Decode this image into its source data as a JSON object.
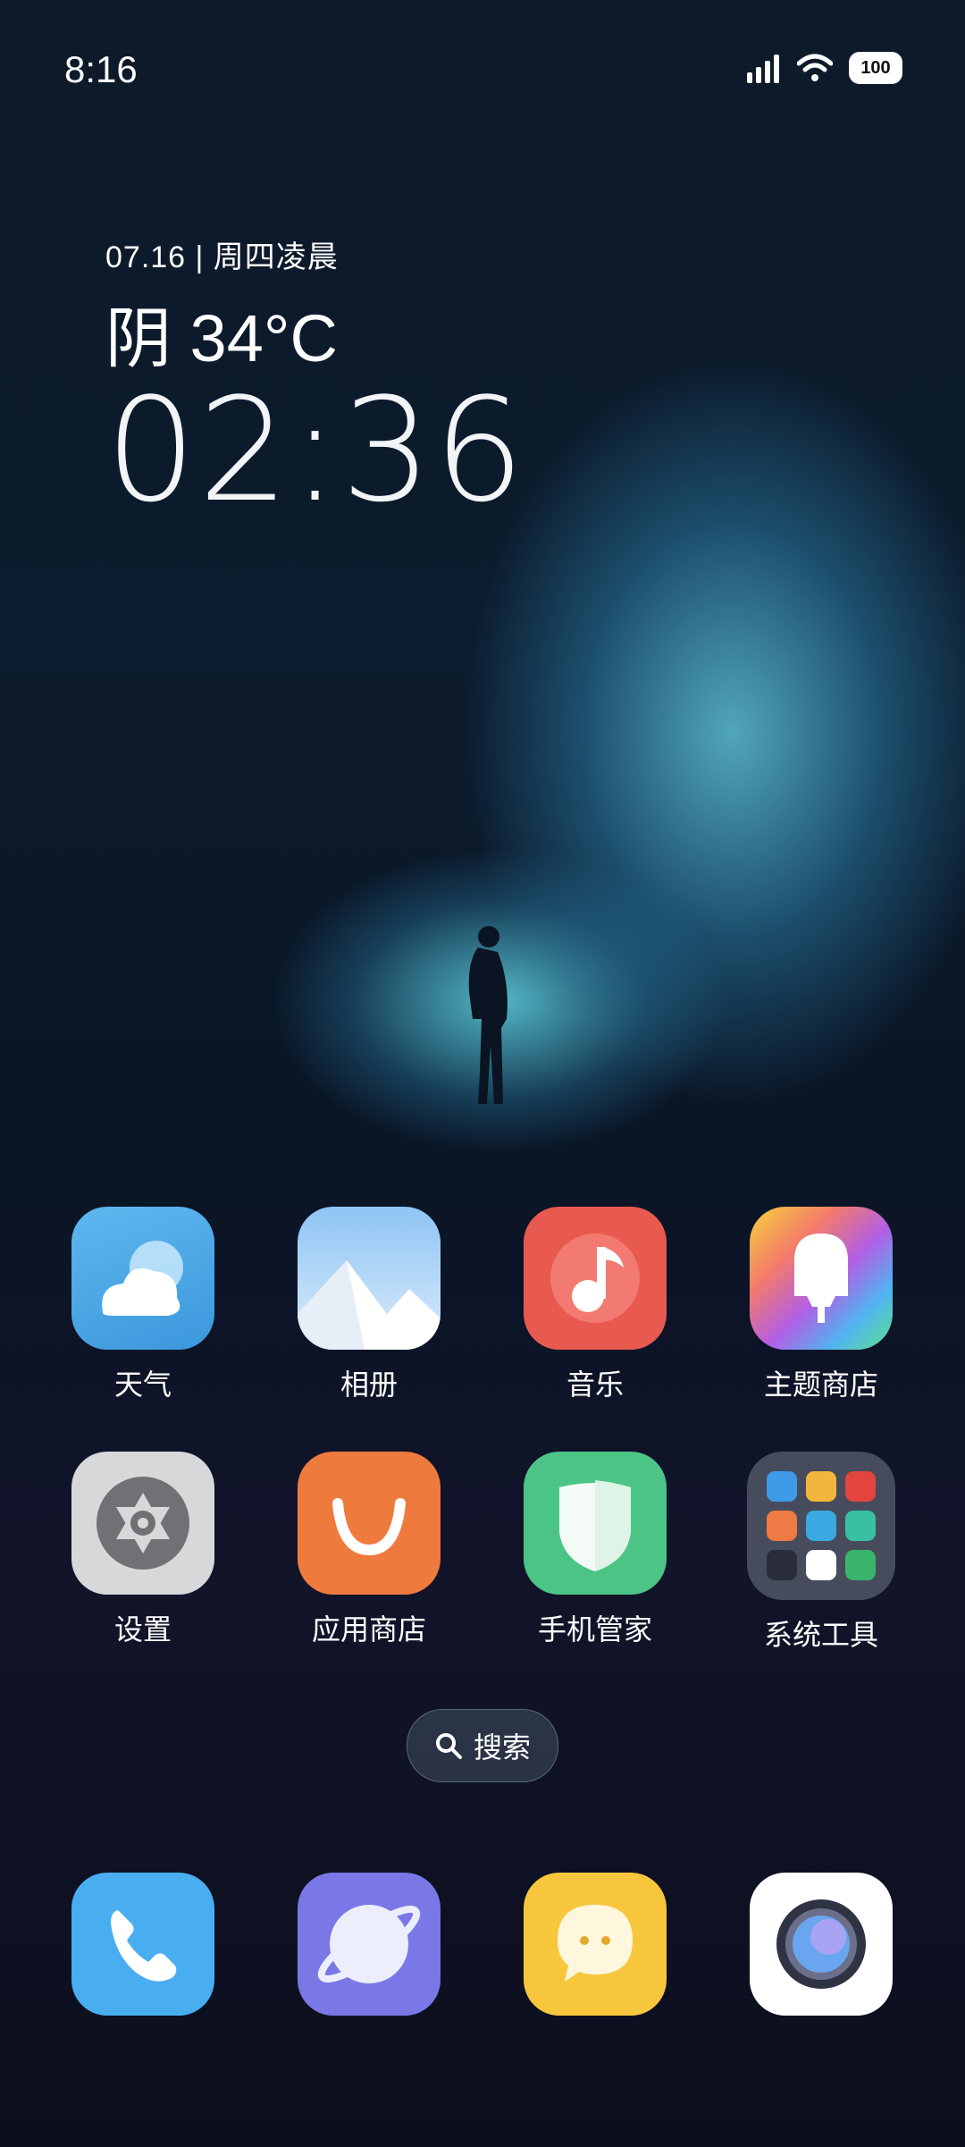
{
  "status_bar": {
    "time": "8:16",
    "battery": "100"
  },
  "widget": {
    "date": "07.16 | 周四凌晨",
    "weather": "阴 34°C",
    "clock": "02:36"
  },
  "apps": {
    "weather": "天气",
    "gallery": "相册",
    "music": "音乐",
    "themes": "主题商店",
    "settings": "设置",
    "app_store": "应用商店",
    "security": "手机管家",
    "tools": "系统工具"
  },
  "search": {
    "label": "搜索"
  },
  "colors": {
    "weather": "#4fa8e6",
    "music": "#e85a50",
    "settings": "#d7d8da",
    "app_store": "#ef7a3e",
    "security": "#4cc486",
    "phone": "#49aef0",
    "browser": "#7a78e6",
    "messages": "#f7c63d"
  }
}
